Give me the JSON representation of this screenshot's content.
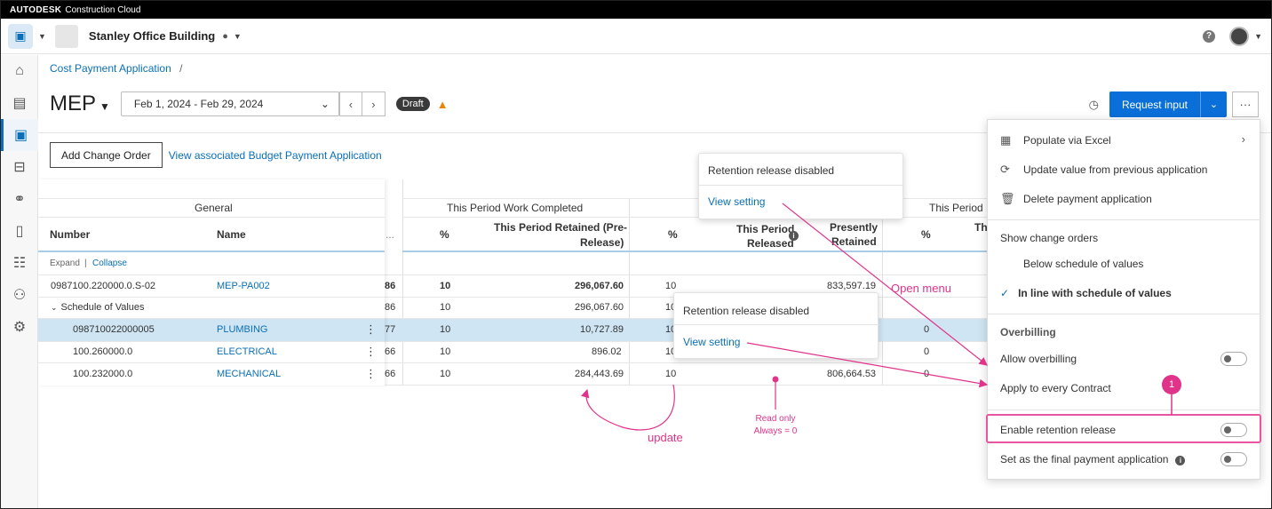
{
  "brand": {
    "company": "AUTODESK",
    "product": "Construction Cloud"
  },
  "project": {
    "name": "Stanley Office Building"
  },
  "breadcrumb": {
    "parent": "Cost Payment Application",
    "separator": "/"
  },
  "page": {
    "title": "MEP",
    "date_range": "Feb 1, 2024 - Feb 29, 2024",
    "status": "Draft",
    "request_input": "Request input"
  },
  "actions": {
    "add_change_order": "Add Change Order",
    "view_budget": "View associated Budget Payment Application"
  },
  "table": {
    "group_general": "General",
    "group_this_period": "This Period Work Completed",
    "group_this_period_2": "This Period R",
    "col_number": "Number",
    "col_name": "Name",
    "col_ellipsis": "...",
    "col_pct": "%",
    "col_retained_pre_1": "This Period Retained (Pre-",
    "col_retained_pre_2": "Release)",
    "col_pct2": "%",
    "col_released_1": "This Period",
    "col_released_2": "Released",
    "col_presently_1": "Presently",
    "col_presently_2": "Retained",
    "col_pct3": "%",
    "col_th": "Th",
    "expand": "Expand",
    "divider": "|",
    "collapse": "Collapse",
    "rows": [
      {
        "number": "0987100.220000.0.S-02",
        "name": "MEP-PA002",
        "trunc": "86",
        "pct": "10",
        "retained": "296,067.60",
        "pct2": "10",
        "presently": "833,597.19",
        "pct3": ""
      },
      {
        "number": "Schedule of Values",
        "name": "",
        "trunc": "86",
        "pct": "10",
        "retained": "296,067.60",
        "pct2": "10",
        "presently": "",
        "pct3": ""
      },
      {
        "number": "098710022000005",
        "name": "PLUMBING",
        "trunc": "77",
        "pct": "10",
        "retained": "10,727.89",
        "pct2": "10",
        "presently": "",
        "pct3": "0"
      },
      {
        "number": "100.260000.0",
        "name": "ELECTRICAL",
        "trunc": "66",
        "pct": "10",
        "retained": "896.02",
        "pct2": "10",
        "presently": "",
        "pct3": "0"
      },
      {
        "number": "100.232000.0",
        "name": "MECHANICAL",
        "trunc": "66",
        "pct": "10",
        "retained": "284,443.69",
        "pct2": "10",
        "presently": "806,664.53",
        "pct3": "0"
      }
    ]
  },
  "popover1": {
    "title": "Retention release disabled",
    "link": "View setting"
  },
  "popover2": {
    "title": "Retention release disabled",
    "link": "View setting"
  },
  "menu": {
    "populate_excel": "Populate via Excel",
    "update_prev": "Update value from previous application",
    "delete_app": "Delete payment application",
    "show_change_orders": "Show change orders",
    "below_sov": "Below schedule of values",
    "inline_sov": "In line with schedule of values",
    "overbilling": "Overbilling",
    "allow_overbilling": "Allow overbilling",
    "apply_every": "Apply to every Contract",
    "enable_retention": "Enable retention release",
    "final_payment": "Set as the final payment application"
  },
  "annotations": {
    "open_menu": "Open menu",
    "update": "update",
    "read_only_1": "Read only",
    "read_only_2": "Always = 0",
    "badge": "1"
  },
  "colors": {
    "accent": "#0a6fd8",
    "annotation": "#e0338a",
    "selected_row": "#cfe5f3"
  }
}
